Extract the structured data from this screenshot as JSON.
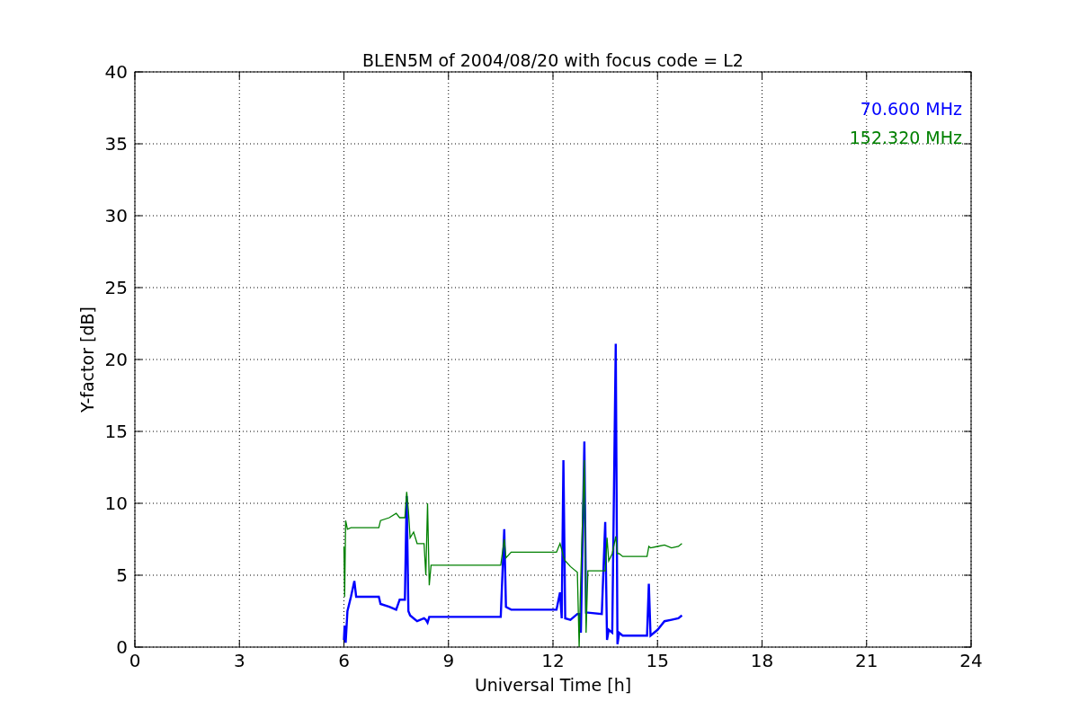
{
  "chart_data": {
    "type": "line",
    "title": "BLEN5M of 2004/08/20 with focus code = L2",
    "xlabel": "Universal Time [h]",
    "ylabel": "Y-factor [dB]",
    "grid": true,
    "xlim": [
      0,
      24
    ],
    "ylim": [
      0,
      40
    ],
    "xticks": [
      0,
      3,
      6,
      9,
      12,
      15,
      18,
      21,
      24
    ],
    "yticks": [
      0,
      5,
      10,
      15,
      20,
      25,
      30,
      35,
      40
    ],
    "x": [
      6.0,
      6.02,
      6.05,
      6.1,
      6.2,
      6.3,
      6.35,
      7.0,
      7.05,
      7.3,
      7.5,
      7.6,
      7.75,
      7.8,
      7.85,
      7.9,
      8.0,
      8.1,
      8.3,
      8.35,
      8.4,
      8.45,
      8.5,
      10.5,
      10.6,
      10.65,
      10.8,
      12.1,
      12.2,
      12.25,
      12.3,
      12.35,
      12.5,
      12.7,
      12.75,
      12.8,
      12.9,
      12.95,
      13.0,
      13.4,
      13.5,
      13.55,
      13.6,
      13.7,
      13.8,
      13.85,
      13.9,
      14.0,
      14.7,
      14.75,
      14.8,
      15.0,
      15.2,
      15.4,
      15.6,
      15.7
    ],
    "series": [
      {
        "name": "70.600 MHz",
        "color": "#0000ff",
        "values": [
          0.5,
          1.5,
          0.3,
          2.5,
          3.5,
          4.6,
          3.5,
          3.5,
          3.0,
          2.8,
          2.6,
          3.3,
          3.3,
          10.5,
          2.5,
          2.2,
          2.0,
          1.8,
          2.0,
          1.9,
          1.7,
          2.1,
          2.1,
          2.1,
          8.2,
          2.8,
          2.6,
          2.6,
          3.8,
          2.0,
          13.0,
          2.0,
          1.9,
          2.3,
          2.3,
          1.0,
          14.3,
          2.4,
          2.4,
          2.3,
          8.7,
          0.5,
          1.2,
          1.0,
          21.1,
          0.2,
          1.0,
          0.8,
          0.8,
          4.4,
          0.8,
          1.2,
          1.8,
          1.9,
          2.0,
          2.2
        ]
      },
      {
        "name": "152.320 MHz",
        "color": "#008000",
        "values": [
          7.0,
          3.5,
          8.8,
          8.2,
          8.3,
          8.3,
          8.3,
          8.3,
          8.8,
          9.0,
          9.3,
          9.0,
          9.0,
          10.8,
          9.5,
          7.6,
          8.0,
          7.2,
          7.2,
          5.0,
          10.0,
          4.3,
          5.7,
          5.7,
          7.5,
          6.2,
          6.6,
          6.6,
          7.2,
          6.8,
          6.3,
          6.0,
          5.6,
          5.2,
          0.0,
          5.0,
          13.0,
          1.0,
          5.3,
          5.3,
          5.3,
          7.6,
          6.0,
          6.5,
          7.7,
          6.5,
          6.5,
          6.3,
          6.3,
          7.0,
          6.9,
          7.0,
          7.1,
          6.9,
          7.0,
          7.2
        ]
      }
    ]
  }
}
